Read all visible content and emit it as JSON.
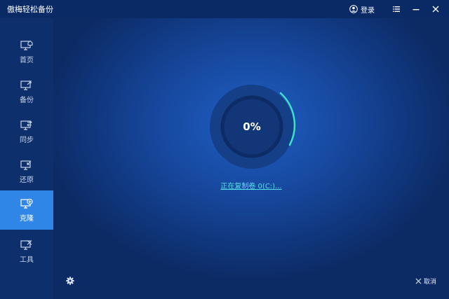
{
  "app": {
    "title": "傲梅轻松备份"
  },
  "titlebar": {
    "login_label": "登录"
  },
  "sidebar": {
    "items": [
      {
        "label": "首页",
        "icon": "home-monitor-icon"
      },
      {
        "label": "备份",
        "icon": "backup-icon"
      },
      {
        "label": "同步",
        "icon": "sync-icon"
      },
      {
        "label": "还原",
        "icon": "restore-icon"
      },
      {
        "label": "克隆",
        "icon": "clone-icon",
        "active": true
      },
      {
        "label": "工具",
        "icon": "tools-icon"
      }
    ]
  },
  "main": {
    "progress_text": "0%",
    "progress_value": 0,
    "status_text": "正在复制卷 0(C:)...",
    "cancel_label": "取消"
  },
  "colors": {
    "accent": "#2f86e6",
    "ring_arc": "#3fe0c8",
    "status_link": "#56e0e6"
  }
}
